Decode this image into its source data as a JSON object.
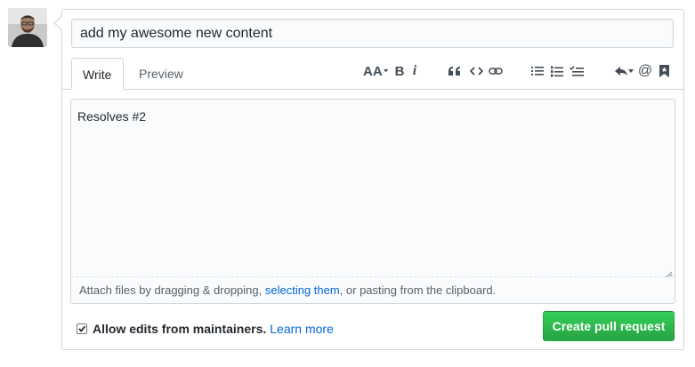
{
  "title_input": {
    "value": "add my awesome new content"
  },
  "tabs": {
    "write": "Write",
    "preview": "Preview"
  },
  "toolbar": {
    "icons": [
      "text-size-icon",
      "bold-icon",
      "italic-icon",
      "quote-icon",
      "code-icon",
      "link-icon",
      "bulleted-list-icon",
      "numbered-list-icon",
      "task-list-icon",
      "reply-icon",
      "mention-icon",
      "saved-reply-icon"
    ],
    "header_glyph": "AA",
    "bold_glyph": "B",
    "italic_glyph": "i",
    "mention_glyph": "@"
  },
  "editor": {
    "value": "Resolves #2"
  },
  "dropzone": {
    "prefix": "Attach files by dragging & dropping, ",
    "link": "selecting them",
    "suffix": ", or pasting from the clipboard."
  },
  "footer": {
    "allow_edits_label": "Allow edits from maintainers.",
    "allow_edits_checked": true,
    "learn_more": "Learn more",
    "create_button": "Create pull request"
  },
  "colors": {
    "primary_button": "#28a745",
    "link": "#0366d6",
    "border": "#d1d5da"
  }
}
